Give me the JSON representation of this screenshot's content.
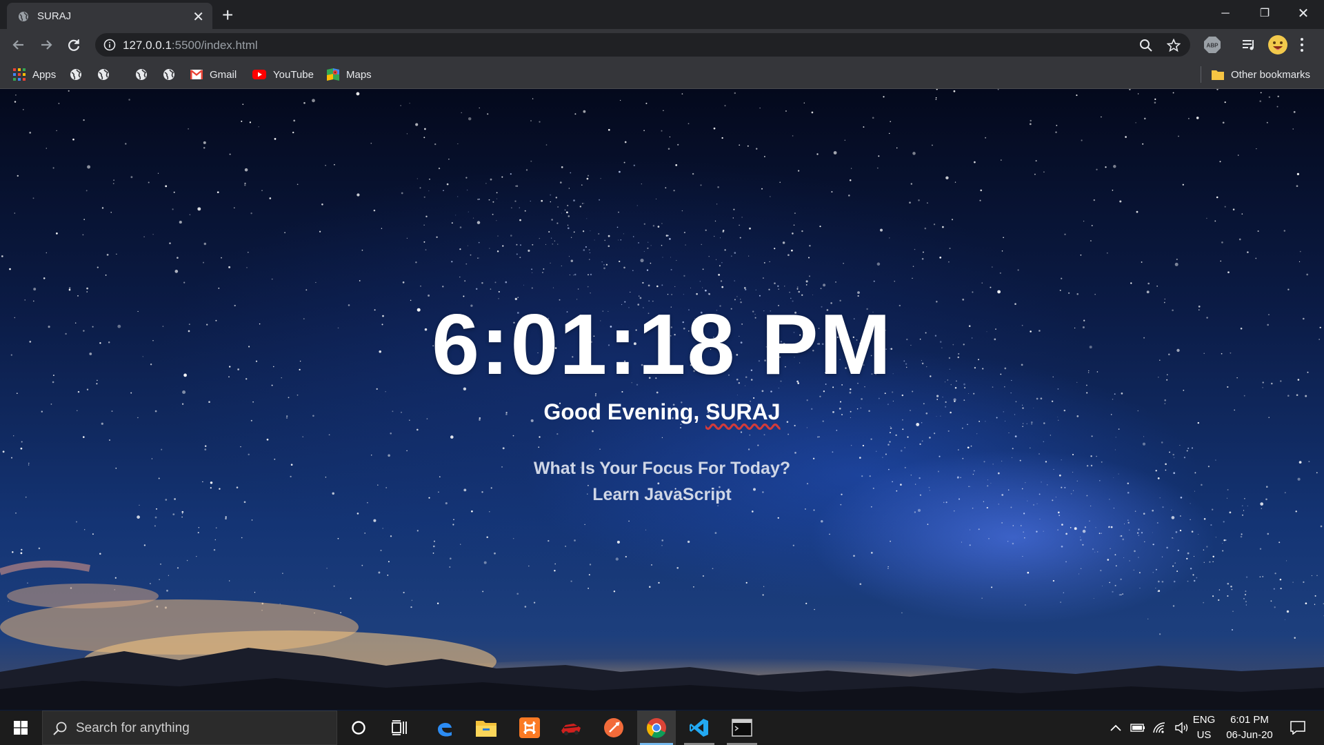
{
  "browser": {
    "tab_title": "SURAJ",
    "url_host": "127.0.0.1",
    "url_path": ":5500/index.html",
    "bookmarks": {
      "apps": "Apps",
      "gmail": "Gmail",
      "youtube": "YouTube",
      "maps": "Maps",
      "other": "Other bookmarks"
    },
    "extension_abp": "ABP"
  },
  "page": {
    "clock": "6:01:18 PM",
    "greeting_prefix": "Good Evening, ",
    "name": "SURAJ",
    "focus_question": "What Is Your Focus For Today?",
    "focus_answer": "Learn JavaScript"
  },
  "taskbar": {
    "search_placeholder": "Search for anything",
    "lang_line1": "ENG",
    "lang_line2": "US",
    "time": "6:01 PM",
    "date": "06-Jun-20"
  },
  "colors": {
    "chrome_dark": "#202124",
    "chrome_toolbar": "#35363a",
    "taskbar": "#1c1c1c",
    "active_indicator": "#76b9ed"
  }
}
